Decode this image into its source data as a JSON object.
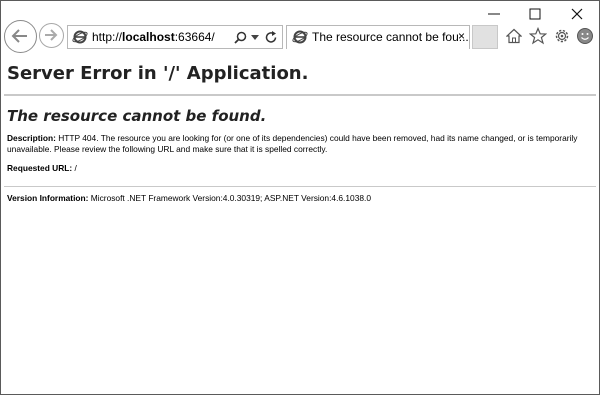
{
  "browser": {
    "address": {
      "prefix": "http://",
      "host": "localhost",
      "port": ":63664/"
    },
    "tab": {
      "title": "The resource cannot be fou...",
      "close_label": "×"
    },
    "icons": [
      "back-arrow-icon",
      "forward-arrow-icon",
      "search-icon",
      "dropdown-arrow-icon",
      "refresh-icon",
      "home-icon",
      "star-icon",
      "gear-icon",
      "smiley-icon"
    ]
  },
  "page": {
    "heading": "Server Error in '/' Application.",
    "subheading": "The resource cannot be found.",
    "description_label": "Description:",
    "description_text": " HTTP 404. The resource you are looking for (or one of its dependencies) could have been removed, had its name changed, or is temporarily unavailable.  Please review the following URL and make sure that it is spelled correctly.",
    "requested_url_label": "Requested URL:",
    "requested_url_value": " /",
    "version_label": "Version Information:",
    "version_text": " Microsoft .NET Framework Version:4.0.30319; ASP.NET Version:4.6.1038.0"
  }
}
